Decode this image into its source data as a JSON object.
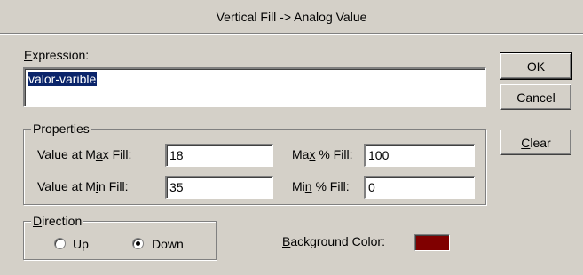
{
  "window": {
    "title": "Vertical Fill -> Analog Value"
  },
  "expression": {
    "label_prefix": "",
    "label_mnemonic": "E",
    "label_rest": "xpression:",
    "value": "valor-varible"
  },
  "buttons": {
    "ok": "OK",
    "cancel": "Cancel",
    "clear_mnemonic": "C",
    "clear_prefix": "",
    "clear_rest_a": "",
    "clear_rest": "lear"
  },
  "properties": {
    "title": "Properties",
    "max_fill_label_a": "Value at M",
    "max_fill_label_m": "a",
    "max_fill_label_b": "x Fill:",
    "max_fill_value": "18",
    "min_fill_label_a": "Value at M",
    "min_fill_label_m": "i",
    "min_fill_label_b": "n Fill:",
    "min_fill_value": "35",
    "max_pct_label_a": "Ma",
    "max_pct_label_m": "x",
    "max_pct_label_b": " % Fill:",
    "max_pct_value": "100",
    "min_pct_label_a": "Mi",
    "min_pct_label_m": "n",
    "min_pct_label_b": " % Fill:",
    "min_pct_value": "0"
  },
  "direction": {
    "title_mnemonic": "D",
    "title_rest": "irection",
    "up_label": "Up",
    "down_label": "Down",
    "selected": "Down"
  },
  "background": {
    "label_mnemonic": "B",
    "label_rest": "ackground Color:",
    "color": "#800000"
  }
}
